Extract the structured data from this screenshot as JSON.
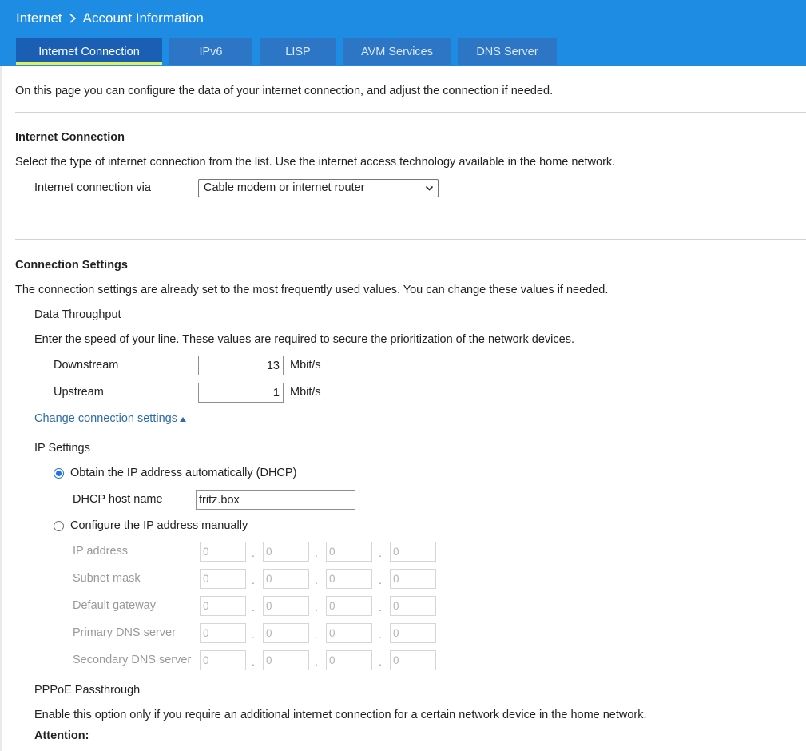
{
  "header": {
    "breadcrumb_section": "Internet",
    "breadcrumb_page": "Account Information",
    "tabs": [
      {
        "label": "Internet Connection"
      },
      {
        "label": "IPv6"
      },
      {
        "label": "LISP"
      },
      {
        "label": "AVM Services"
      },
      {
        "label": "DNS Server"
      }
    ]
  },
  "intro": "On this page you can configure the data of your internet connection, and adjust the connection if needed.",
  "internet_connection": {
    "heading": "Internet Connection",
    "description": "Select the type of internet connection from the list. Use the internet access technology available in the home network.",
    "via_label": "Internet connection via",
    "via_value": "Cable modem or internet router"
  },
  "connection_settings": {
    "heading": "Connection Settings",
    "description": "The connection settings are already set to the most frequently used values. You can change these values if needed.",
    "throughput_heading": "Data Throughput",
    "throughput_description": "Enter the speed of your line. These values are required to secure the prioritization of the network devices.",
    "downstream_label": "Downstream",
    "downstream_value": "13",
    "upstream_label": "Upstream",
    "upstream_value": "1",
    "unit": "Mbit/s",
    "change_link": "Change connection settings"
  },
  "ip_settings": {
    "heading": "IP Settings",
    "dhcp_option": "Obtain the IP address automatically (DHCP)",
    "dhcp_host_label": "DHCP host name",
    "dhcp_host_value": "fritz.box",
    "manual_option": "Configure the IP address manually",
    "fields": [
      {
        "label": "IP address",
        "octets": [
          "0",
          "0",
          "0",
          "0"
        ]
      },
      {
        "label": "Subnet mask",
        "octets": [
          "0",
          "0",
          "0",
          "0"
        ]
      },
      {
        "label": "Default gateway",
        "octets": [
          "0",
          "0",
          "0",
          "0"
        ]
      },
      {
        "label": "Primary DNS server",
        "octets": [
          "0",
          "0",
          "0",
          "0"
        ]
      },
      {
        "label": "Secondary DNS server",
        "octets": [
          "0",
          "0",
          "0",
          "0"
        ]
      }
    ],
    "separator": "."
  },
  "pppoe": {
    "heading": "PPPoE Passthrough",
    "description": "Enable this option only if you require an additional internet connection for a certain network device in the home network.",
    "attention": "Attention:"
  },
  "colors": {
    "header_bg": "#1f8ce3",
    "tab_bg": "#2d76c5",
    "tab_active_bg": "#1a5fb3",
    "tab_active_underline": "#e2f05a",
    "link": "#2d6ca8",
    "radio_checked": "#1a73e8"
  }
}
